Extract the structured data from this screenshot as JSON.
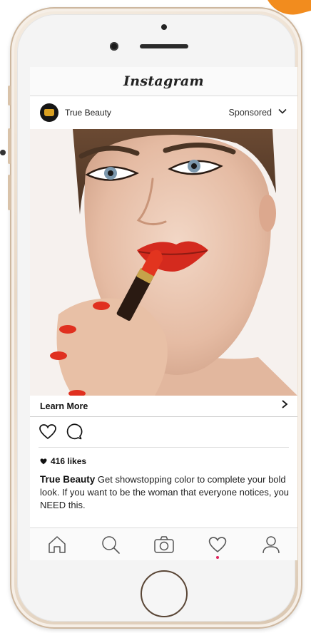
{
  "app": {
    "title": "Instagram"
  },
  "post": {
    "account_name": "True Beauty",
    "sponsored_label": "Sponsored",
    "cta_label": "Learn More",
    "likes": "416 likes",
    "caption_author": "True Beauty",
    "caption_text": " Get showstopping color to complete your bold look. If you want to be the woman that everyone notices, you NEED this."
  },
  "tabs": [
    {
      "name": "home",
      "icon": "home-icon"
    },
    {
      "name": "search",
      "icon": "search-icon"
    },
    {
      "name": "camera",
      "icon": "camera-icon"
    },
    {
      "name": "activity",
      "icon": "heart-icon",
      "has_notification": true
    },
    {
      "name": "profile",
      "icon": "profile-icon"
    }
  ],
  "colors": {
    "accent_orange": "#f28c1e",
    "lip_red": "#d42a1e",
    "notification": "#e0245e",
    "phone_gold": "#e8d8c6"
  }
}
